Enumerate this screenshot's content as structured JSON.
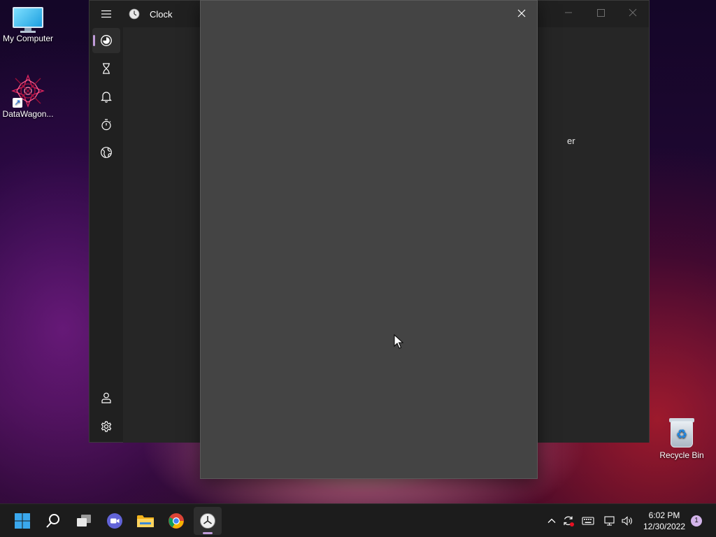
{
  "desktop": {
    "icons": [
      {
        "label": "My Computer",
        "icon": "computer-icon"
      },
      {
        "label": "DataWagon...",
        "icon": "datawagon-logo-icon"
      },
      {
        "label": "Recycle Bin",
        "icon": "recycle-bin-icon"
      }
    ]
  },
  "clock_window": {
    "title": "Clock",
    "app_icon": "clock-app-icon",
    "partial_text": "er",
    "nav": [
      {
        "id": "focus",
        "icon": "focus-sessions-icon",
        "active": true
      },
      {
        "id": "timer",
        "icon": "hourglass-icon",
        "active": false
      },
      {
        "id": "alarm",
        "icon": "bell-icon",
        "active": false
      },
      {
        "id": "stopwatch",
        "icon": "stopwatch-icon",
        "active": false
      },
      {
        "id": "world-clock",
        "icon": "globe-icon",
        "active": false
      }
    ],
    "nav_bottom": [
      {
        "id": "account",
        "icon": "person-icon"
      },
      {
        "id": "settings",
        "icon": "gear-icon"
      }
    ],
    "window_controls": [
      "minimize-icon",
      "maximize-icon",
      "close-icon"
    ]
  },
  "dialog": {
    "close_icon": "close-icon"
  },
  "taskbar": {
    "pinned": [
      {
        "id": "start",
        "icon": "windows-logo-icon"
      },
      {
        "id": "search",
        "icon": "search-icon"
      },
      {
        "id": "task-view",
        "icon": "task-view-icon"
      },
      {
        "id": "chat",
        "icon": "video-chat-icon"
      },
      {
        "id": "file-explorer",
        "icon": "folder-icon"
      },
      {
        "id": "chrome",
        "icon": "chrome-icon"
      },
      {
        "id": "clock",
        "icon": "clock-app-icon",
        "running": true
      }
    ],
    "tray": {
      "icons": [
        "chevron-up-icon",
        "sync-icon",
        "keyboard-icon",
        "network-icon",
        "volume-icon"
      ],
      "time": "6:02 PM",
      "date": "12/30/2022",
      "notification_count": "1"
    }
  },
  "colors": {
    "accent": "#c09cd9",
    "window_bg": "#202020",
    "dialog_bg": "#444444",
    "taskbar_bg": "#1c1c1c"
  }
}
